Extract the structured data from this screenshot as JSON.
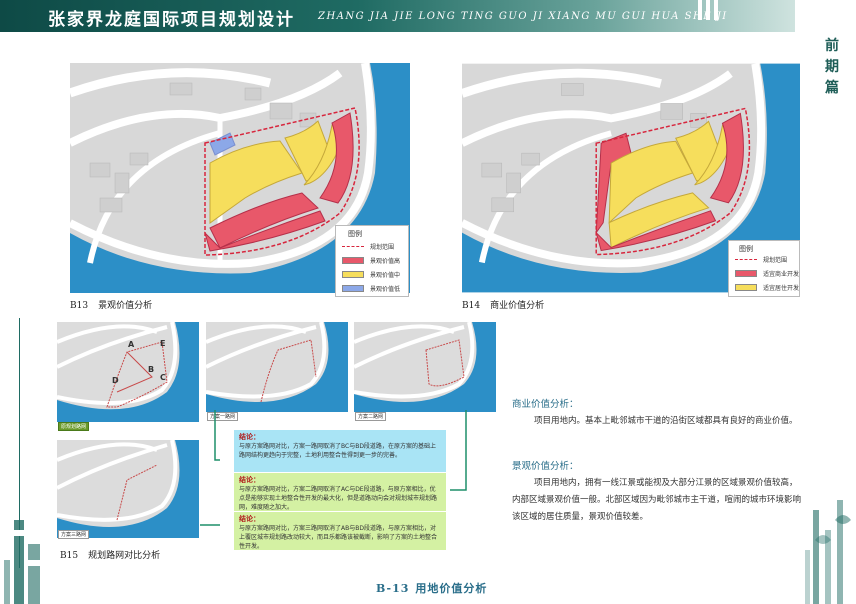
{
  "header": {
    "title": "张家界龙庭国际项目规划设计",
    "pinyin": "ZHANG JIA JIE LONG TING GUO JI XIANG MU GUI HUA SHE JI"
  },
  "side_title": [
    "前",
    "期",
    "篇"
  ],
  "map_b13": {
    "code": "B13",
    "title": "景观价值分析",
    "legend": {
      "title": "图例",
      "items": [
        "规划范围",
        "景观价值高",
        "景观价值中",
        "景观价值低"
      ]
    }
  },
  "map_b14": {
    "code": "B14",
    "title": "商业价值分析",
    "legend": {
      "title": "图例",
      "items": [
        "规划范围",
        "适宜商业开发",
        "适宜居住开发"
      ]
    }
  },
  "b15": {
    "code": "B15",
    "title": "规划路网对比分析",
    "labels": {
      "current": "原规划路网",
      "plan1": "方案一路网",
      "plan2": "方案二路网",
      "plan3": "方案三路网"
    },
    "points": [
      "A",
      "B",
      "C",
      "D",
      "E"
    ],
    "conclusions": [
      {
        "title": "结论：",
        "text": "与原方案路网对比，方案一路网取消了BC与BD段道路，在原方案的基础上路网结构更趋向于完整，土地利用整合性得到更一步的完善。"
      },
      {
        "title": "结论：",
        "text": "与原方案路网对比，方案二路网取消了AC与DE段道路，与原方案相比，优点是能够实现土地整合性开发的最大化，但是道路动向会对规划城市规划路网，难度随之加大。"
      },
      {
        "title": "结论：",
        "text": "与原方案路网对比，方案三路网取消了AB与BD段道路，与原方案相比，对上覆区城市规划路改动较大，而且乐都路该被截断，影响了方案的土地整合性开发。"
      }
    ],
    "colors": {
      "blue": "#a9e4f5",
      "green": "#d4f1a3",
      "accent": "#1f8f6a"
    }
  },
  "analysis": {
    "commercial": {
      "heading": "商业价值分析：",
      "text": "项目用地内。基本上毗邻城市干道的沿街区域都具有良好的商业价值。"
    },
    "landscape": {
      "heading": "景观价值分析：",
      "lines": [
        "项目用地内，拥有一线江景或能视及大部分江景的区域景观价值较高，",
        "内部区域景观价值一般。北部区域因为毗邻城市主干道，喧闹的城市环境影响",
        "该区域的居住质量，景观价值较差。"
      ]
    }
  },
  "footer": {
    "code": "B-13",
    "title": "用地价值分析"
  },
  "colors": {
    "header": "#1f6b63",
    "river": "#2c8fc7",
    "land": "#dcdcdc",
    "red": "#e8586a",
    "yellow": "#f6de5c",
    "blue": "#8ca8e8",
    "boundary": "#d7263d",
    "title_blue": "#2a6e8a"
  }
}
